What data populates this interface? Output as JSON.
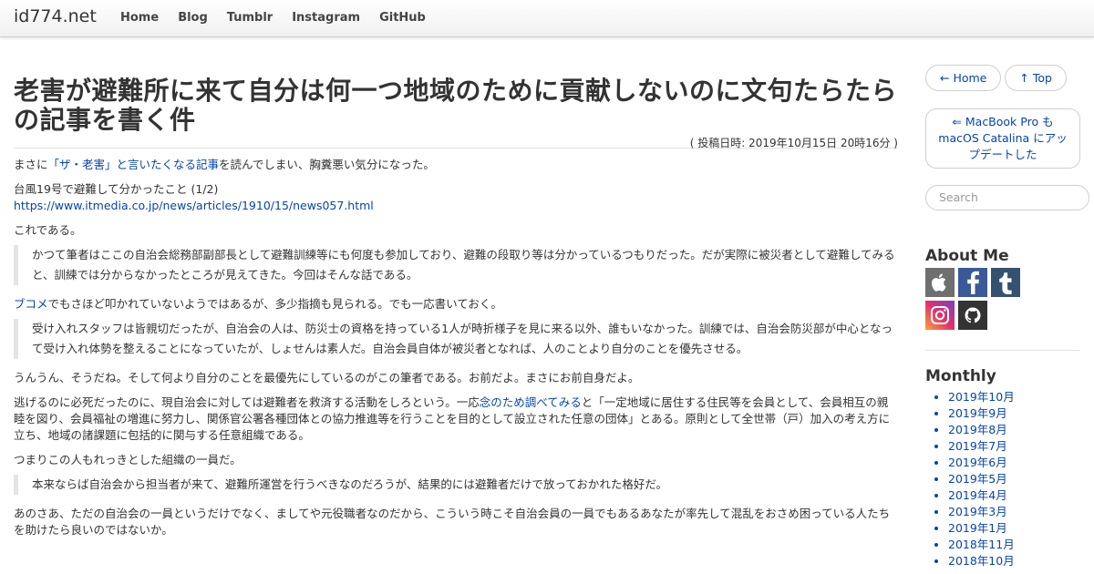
{
  "navbar": {
    "brand": "id774.net",
    "links": [
      "Home",
      "Blog",
      "Tumblr",
      "Instagram",
      "GitHub"
    ]
  },
  "article": {
    "title": "老害が避難所に来て自分は何一つ地域のために貢献しないのに文句たらたらの記事を書く件",
    "posted": "( 投稿日時: 2019年10月15日 20時16分 )",
    "p1_pre": "まさに",
    "p1_link": "「ザ・老害」と言いたくなる記事",
    "p1_post": "を読んでしまい、胸糞悪い気分になった。",
    "p2_text": "台風19号で避難して分かったこと (1/2)",
    "p2_url": "https://www.itmedia.co.jp/news/articles/1910/15/news057.html",
    "p3": "これである。",
    "quote1": "かつて筆者はここの自治会総務部副部長として避難訓練等にも何度も参加しており、避難の段取り等は分かっているつもりだった。だが実際に被災者として避難してみると、訓練では分からなかったところが見えてきた。今回はそんな話である。",
    "p4_link": "ブコメ",
    "p4_post": "でもさほど叩かれていないようではあるが、多少指摘も見られる。でも一応書いておく。",
    "quote2": "受け入れスタッフは皆親切だったが、自治会の人は、防災士の資格を持っている1人が時折様子を見に来る以外、誰もいなかった。訓練では、自治会防災部が中心となって受け入れ体勢を整えることになっていたが、しょせんは素人だ。自治会員自体が被災者となれば、人のことより自分のことを優先させる。",
    "p5": "うんうん、そうだね。そして何より自分のことを最優先にしているのがこの筆者である。お前だよ。まさにお前自身だよ。",
    "p6_pre": "逃げるのに必死だったのに、現自治会に対しては避難者を救済する活動をしろという。一応",
    "p6_link": "念のため調べてみる",
    "p6_post": "と「一定地域に居住する住民等を会員として、会員相互の親睦を図り、会員福祉の増進に努力し、関係官公署各種団体との協力推進等を行うことを目的として設立された任意の団体」とある。原則として全世帯（戸）加入の考え方に立ち、地域の諸課題に包括的に関与する任意組織である。",
    "p7": "つまりこの人もれっきとした組織の一員だ。",
    "quote3": "本来ならば自治会から担当者が来て、避難所運営を行うべきなのだろうが、結果的には避難者だけで放っておかれた格好だ。",
    "p8": "あのさあ、ただの自治会の一員というだけでなく、ましてや元役職者なのだから、こういう時こそ自治会員の一員でもあるあなたが率先して混乱をおさめ困っている人たちを助けたら良いのではないか。"
  },
  "sidebar": {
    "home_button": "← Home",
    "top_button": "↑ Top",
    "prev_post": "⇐ MacBook Pro も macOS Catalina にアップデートした",
    "search_placeholder": "Search",
    "about_heading": "About Me",
    "about_icons": [
      "apple-icon",
      "facebook-icon",
      "tumblr-icon",
      "instagram-icon",
      "github-icon"
    ],
    "monthly_heading": "Monthly",
    "months": [
      "2019年10月",
      "2019年9月",
      "2019年8月",
      "2019年7月",
      "2019年6月",
      "2019年5月",
      "2019年4月",
      "2019年3月",
      "2019年1月",
      "2018年11月",
      "2018年10月"
    ]
  },
  "colors": {
    "link": "#0645ad",
    "text": "#333333",
    "facebook": "#3b5998",
    "tumblr": "#34526f"
  }
}
